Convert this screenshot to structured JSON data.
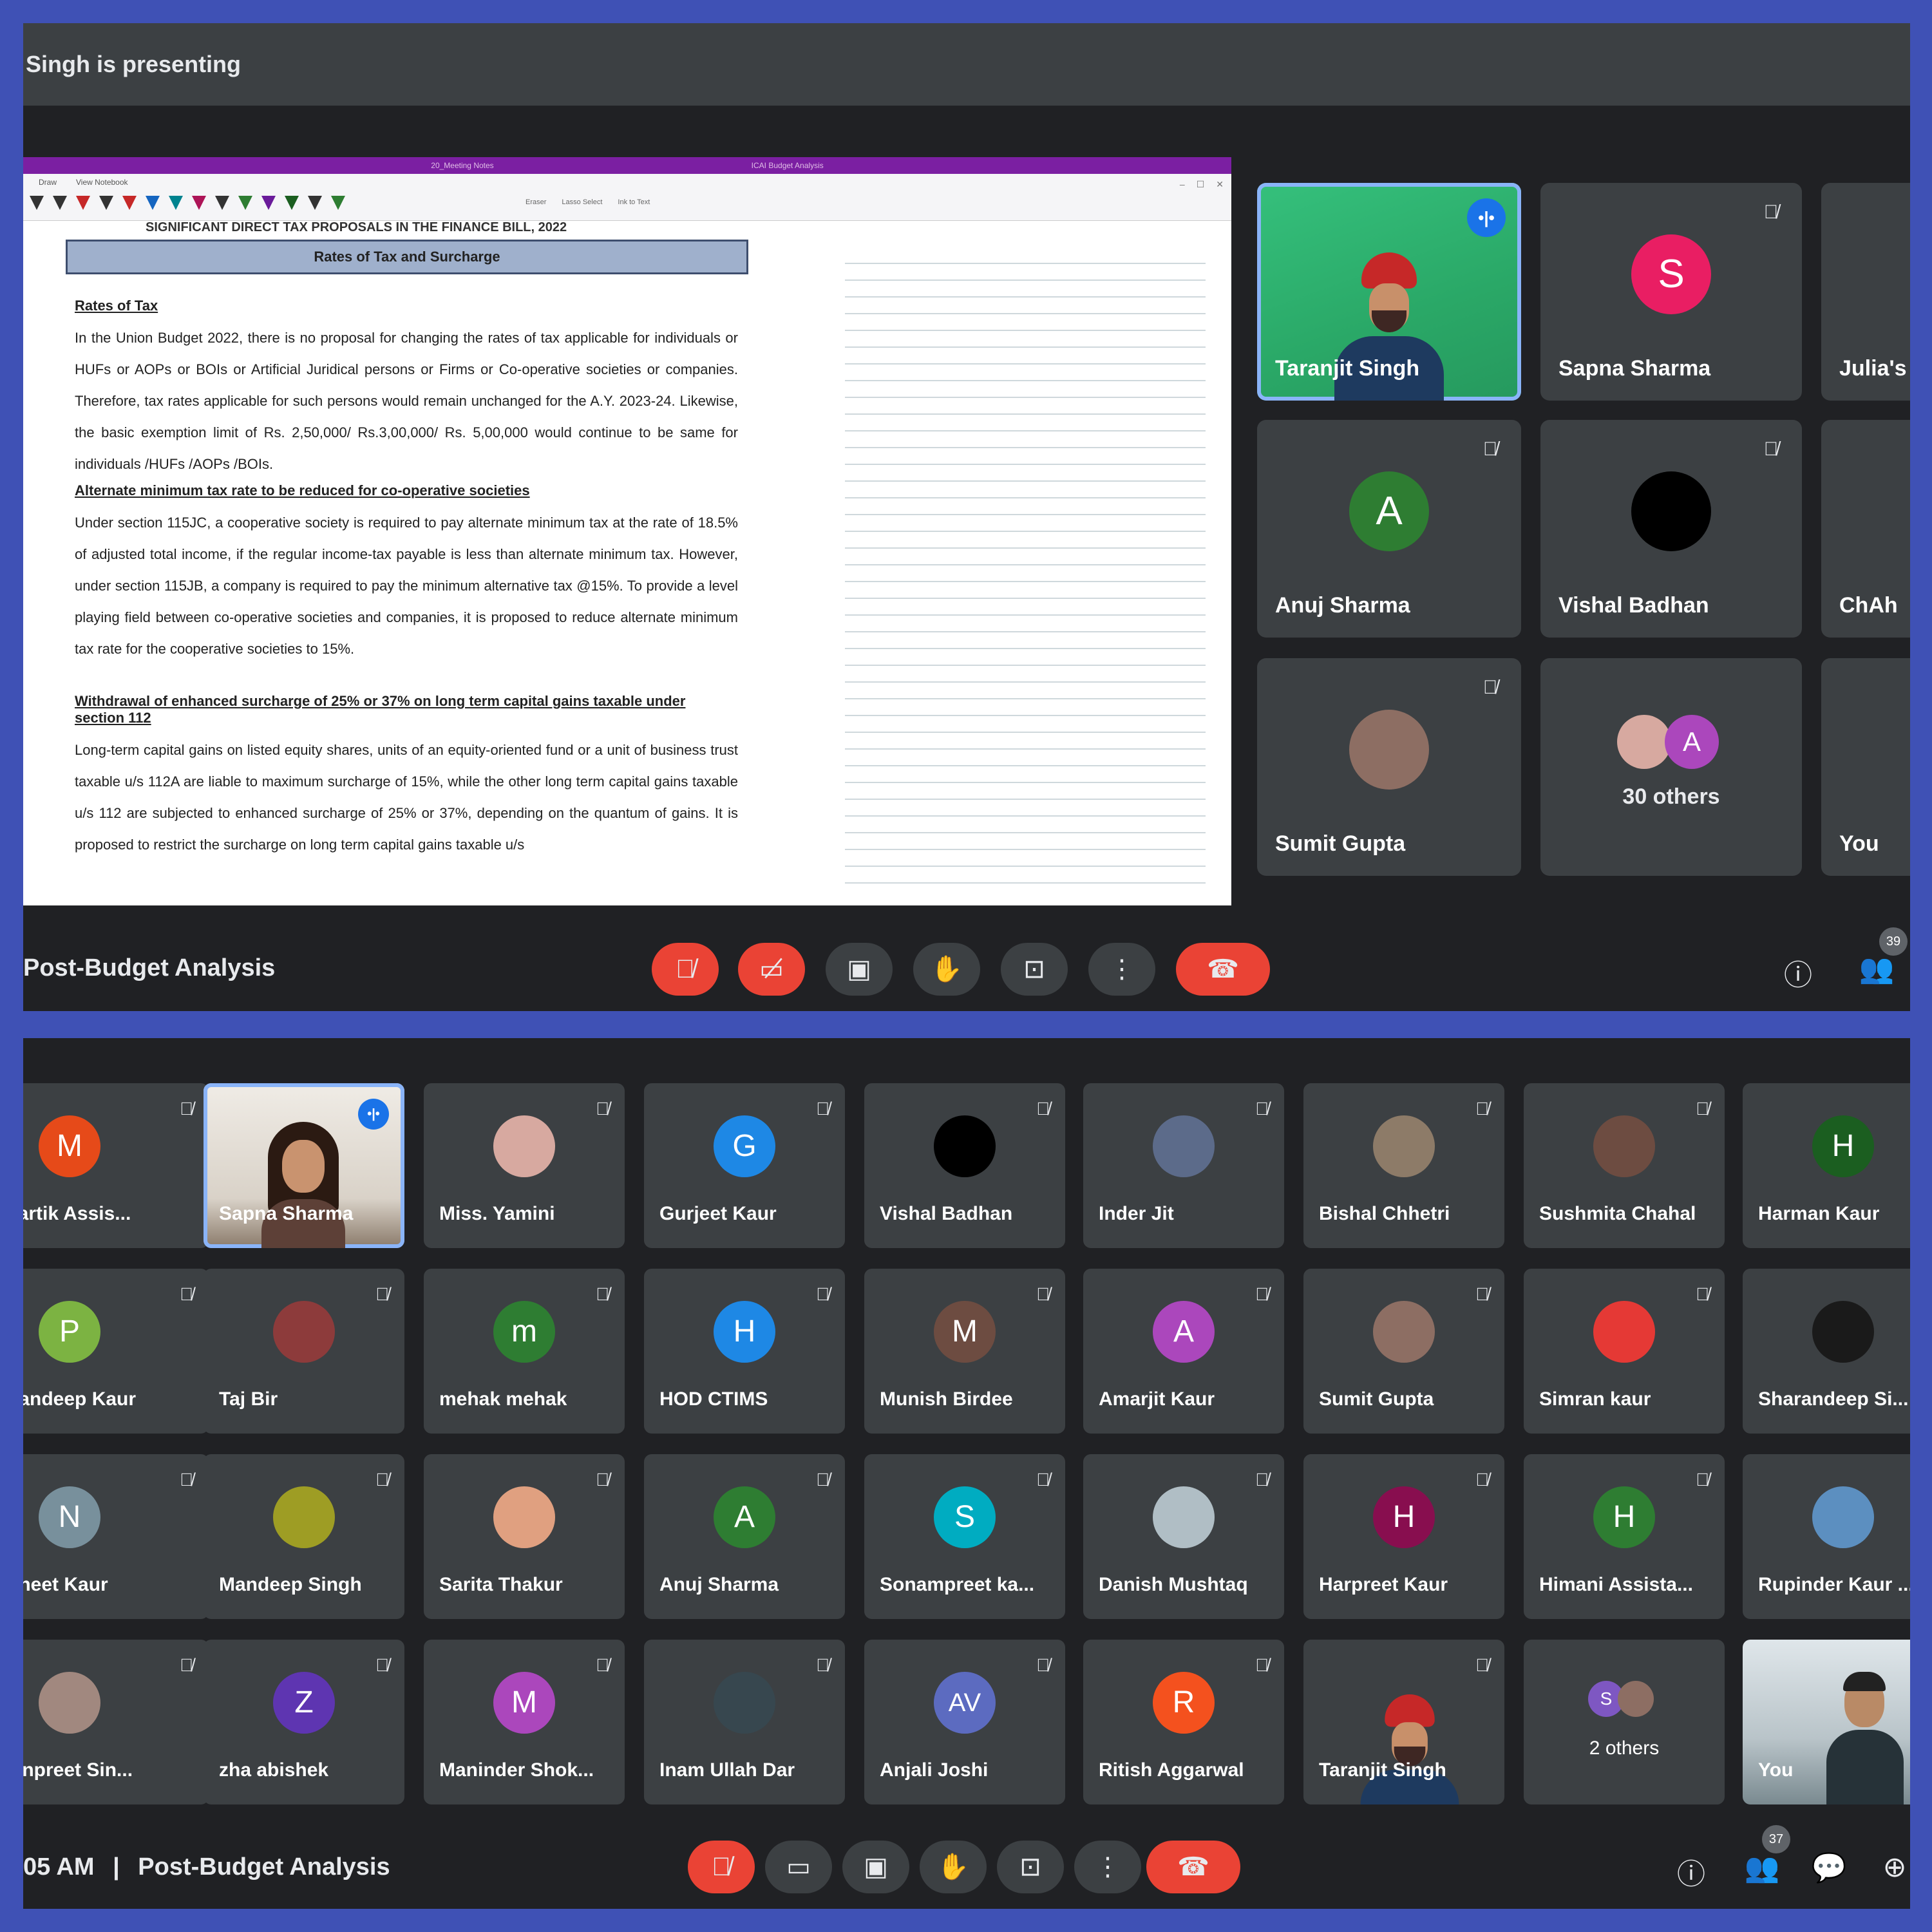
{
  "top": {
    "presenting_text": "Singh is presenting",
    "document": {
      "window_title": "20_Meeting Notes",
      "window_title_right": "ICAI Budget Analysis",
      "ribbon_tabs": [
        "Draw",
        "View Notebook"
      ],
      "ribbon_right": [
        "Eraser",
        "Lasso Select",
        "Ink to Text"
      ],
      "heading": "SIGNIFICANT DIRECT TAX PROPOSALS IN THE FINANCE BILL, 2022",
      "band": "Rates of Tax and Surcharge",
      "sub1": "Rates of Tax",
      "para1": "In the Union Budget 2022, there is no proposal for changing the rates of tax applicable for individuals or HUFs or AOPs or BOIs or Artificial Juridical persons or Firms or Co-operative societies or companies. Therefore, tax rates applicable for such persons would remain unchanged for the A.Y. 2023-24. Likewise, the basic exemption limit of Rs. 2,50,000/ Rs.3,00,000/ Rs. 5,00,000 would continue to be same for individuals /HUFs /AOPs /BOIs.",
      "sub2": "Alternate minimum tax rate to be reduced for co-operative societies",
      "para2": "Under section 115JC, a cooperative society is required to pay alternate minimum tax at the rate of 18.5% of adjusted total income, if the regular income-tax payable is less than alternate minimum tax. However, under section 115JB, a company is required to pay the minimum alternative tax @15%. To provide a level playing field between co-operative societies and companies, it is proposed to reduce alternate minimum tax rate for the cooperative societies to 15%.",
      "sub3": "Withdrawal of enhanced surcharge of 25% or 37% on long term capital gains taxable under section 112",
      "para3": "Long-term capital gains on listed equity shares, units of an equity-oriented fund or a unit of business trust taxable u/s 112A are liable to maximum surcharge of 15%, while the other long term capital gains taxable u/s 112 are subjected to enhanced surcharge of 25% or 37%, depending on the quantum of gains. It is proposed to restrict the surcharge on long term capital gains taxable u/s"
    },
    "tiles": [
      {
        "name": "Taranjit Singh",
        "type": "video"
      },
      {
        "name": "Sapna Sharma",
        "initial": "S",
        "color": "#e91e63"
      },
      {
        "name": "Julia's",
        "initial": "",
        "color": "#3c4043"
      },
      {
        "name": "Anuj Sharma",
        "initial": "A",
        "color": "#2e7d32"
      },
      {
        "name": "Vishal Badhan",
        "initial": "",
        "color": "#000000"
      },
      {
        "name": "ChAh",
        "initial": "",
        "color": "#3c4043"
      },
      {
        "name": "Sumit Gupta",
        "initial": "",
        "color": "#8d6e63"
      },
      {
        "name": "30 others",
        "type": "others"
      },
      {
        "name": "You",
        "initial": "",
        "color": "#3c4043"
      }
    ],
    "meeting_title": "Post-Budget Analysis",
    "people_count": "39"
  },
  "bottom": {
    "tiles": [
      {
        "name": "Kartik Assis...",
        "initial": "M",
        "color": "#e64a19"
      },
      {
        "name": "Sapna Sharma",
        "type": "photo"
      },
      {
        "name": "Miss. Yamini",
        "initial": "",
        "color": "#d7a9a0"
      },
      {
        "name": "Gurjeet Kaur",
        "initial": "G",
        "color": "#1e88e5"
      },
      {
        "name": "Vishal Badhan",
        "initial": "",
        "color": "#000000"
      },
      {
        "name": "Inder Jit",
        "initial": "",
        "color": "#5c6b8a"
      },
      {
        "name": "Bishal Chhetri",
        "initial": "",
        "color": "#8d7b68"
      },
      {
        "name": "Sushmita Chahal",
        "initial": "",
        "color": "#6d4c41"
      },
      {
        "name": "Harman Kaur",
        "initial": "H",
        "color": "#1b5e20"
      },
      {
        "name": "wandeep Kaur",
        "initial": "P",
        "color": "#7cb342"
      },
      {
        "name": "Taj Bir",
        "initial": "",
        "color": "#8d3b3b"
      },
      {
        "name": "mehak mehak",
        "initial": "m",
        "color": "#2e7d32"
      },
      {
        "name": "HOD CTIMS",
        "initial": "H",
        "color": "#1e88e5"
      },
      {
        "name": "Munish Birdee",
        "initial": "M",
        "color": "#6d4c41"
      },
      {
        "name": "Amarjit Kaur",
        "initial": "A",
        "color": "#ab47bc"
      },
      {
        "name": "Sumit Gupta",
        "initial": "",
        "color": "#8d6e63"
      },
      {
        "name": "Simran kaur",
        "initial": "",
        "color": "#e53935"
      },
      {
        "name": "Sharandeep Si...",
        "initial": "",
        "color": "#1a1a1a"
      },
      {
        "name": "wneet Kaur",
        "initial": "N",
        "color": "#78909c"
      },
      {
        "name": "Mandeep Singh",
        "initial": "",
        "color": "#9e9d24"
      },
      {
        "name": "Sarita Thakur",
        "initial": "",
        "color": "#e0a080"
      },
      {
        "name": "Anuj Sharma",
        "initial": "A",
        "color": "#2e7d32"
      },
      {
        "name": "Sonampreet ka...",
        "initial": "S",
        "color": "#00acc1"
      },
      {
        "name": "Danish Mushtaq",
        "initial": "",
        "color": "#b0bec5"
      },
      {
        "name": "Harpreet Kaur",
        "initial": "H",
        "color": "#880e4f"
      },
      {
        "name": "Himani Assista...",
        "initial": "H",
        "color": "#2e7d32"
      },
      {
        "name": "Rupinder Kaur ...",
        "initial": "",
        "color": "#5c8fc0"
      },
      {
        "name": "ranpreet Sin...",
        "initial": "",
        "color": "#a1887f"
      },
      {
        "name": "zha abishek",
        "initial": "Z",
        "color": "#5e35b1"
      },
      {
        "name": "Maninder Shok...",
        "initial": "M",
        "color": "#ab47bc"
      },
      {
        "name": "Inam Ullah Dar",
        "initial": "",
        "color": "#37474f"
      },
      {
        "name": "Anjali Joshi",
        "initial": "AV",
        "color": "#5c6bc0"
      },
      {
        "name": "Ritish Aggarwal",
        "initial": "R",
        "color": "#f4511e"
      },
      {
        "name": "Taranjit Singh",
        "type": "video"
      },
      {
        "name": "2 others",
        "type": "others"
      },
      {
        "name": "You",
        "type": "office"
      }
    ],
    "time": "05 AM",
    "separator": "|",
    "meeting_title": "Post-Budget Analysis",
    "people_count": "37"
  },
  "icons": {
    "mic_off": "mic-off-icon",
    "cam_off": "camera-off-icon",
    "captions": "captions-icon",
    "raise_hand": "raise-hand-icon",
    "present": "present-icon",
    "more": "more-options-icon",
    "end_call": "end-call-icon",
    "info": "info-icon",
    "people": "people-icon",
    "chat": "chat-icon",
    "activities": "activities-icon"
  },
  "colors": {
    "frame": "#3f51b5",
    "meet_bg": "#202124",
    "tile_bg": "#3c4043",
    "danger": "#ea4335",
    "speaker_blue": "#1a73e8"
  }
}
